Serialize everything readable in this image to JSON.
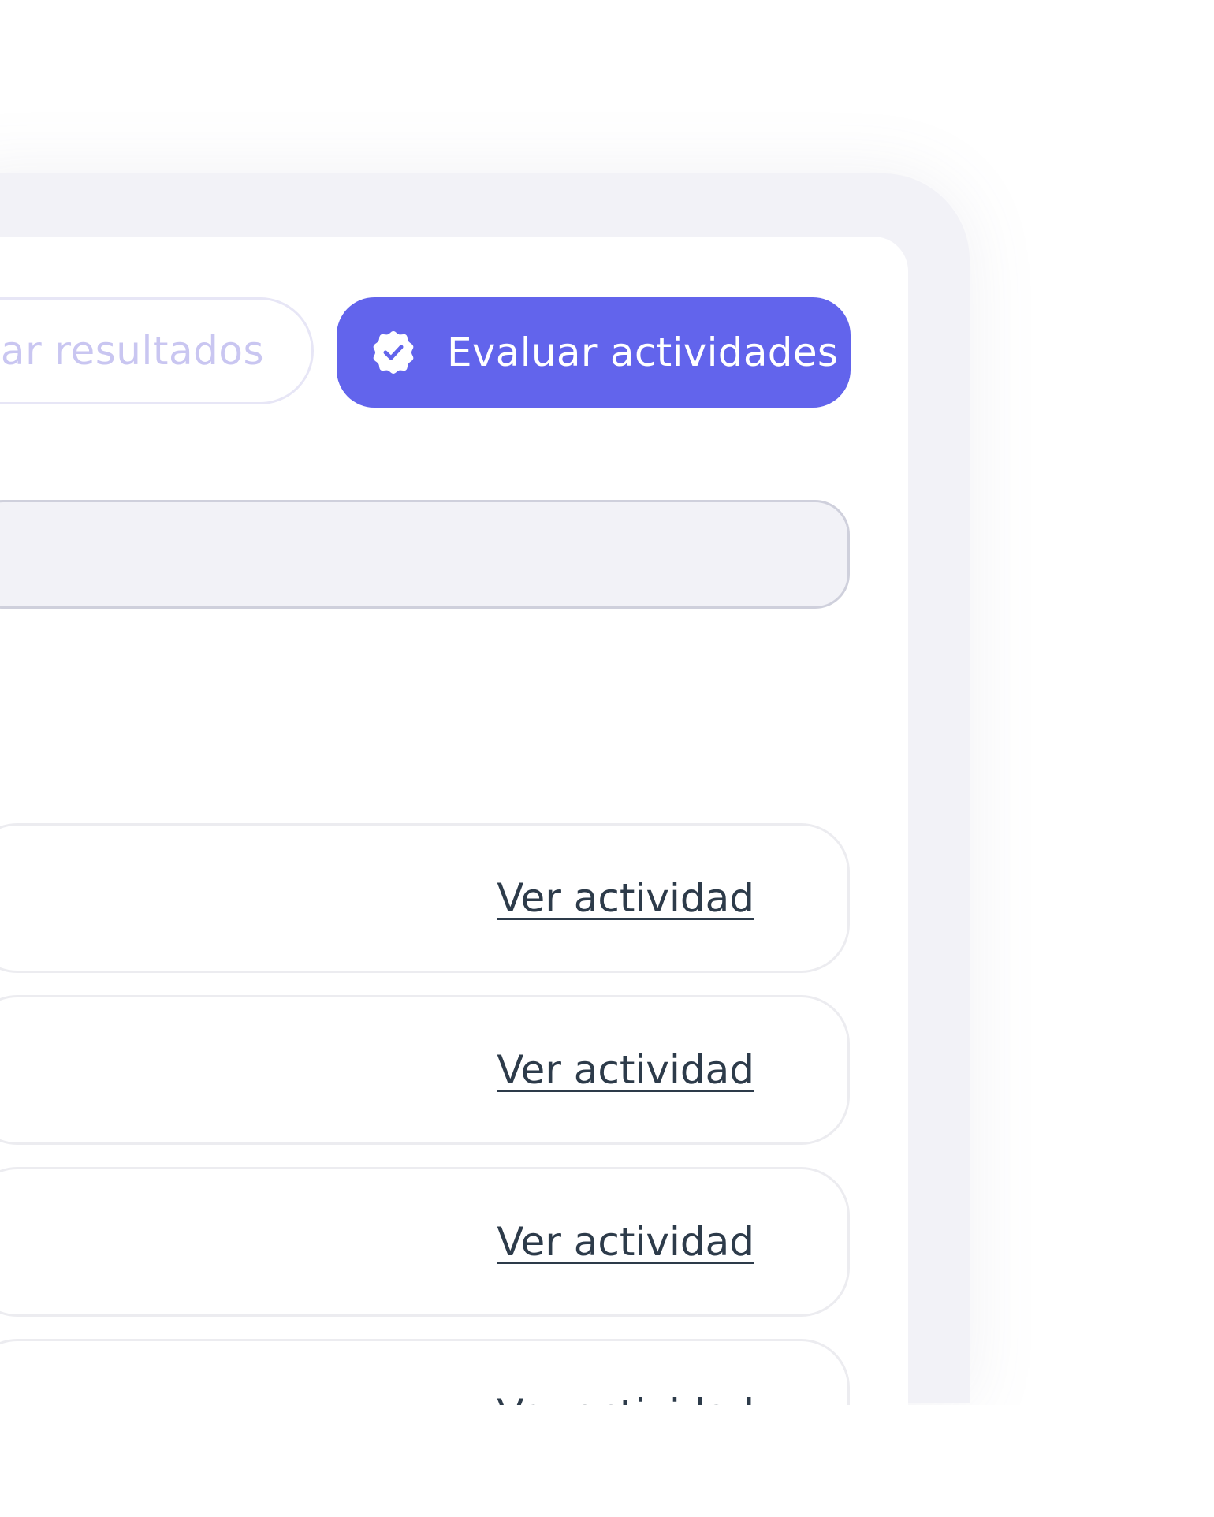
{
  "toolbar": {
    "secondary_button_label": "viar resultados",
    "primary_button_label": "Evaluar actividades",
    "primary_icon": "check-badge-icon"
  },
  "search": {
    "value": ""
  },
  "activities": [
    {
      "link_label": "Ver actividad"
    },
    {
      "link_label": "Ver actividad"
    },
    {
      "link_label": "Ver actividad"
    },
    {
      "link_label": "Ver actividad"
    }
  ],
  "colors": {
    "primary": "#6264ec",
    "secondary_text": "#c9c6f1",
    "link_text": "#2d3b4a",
    "frame": "#f2f2f7"
  }
}
